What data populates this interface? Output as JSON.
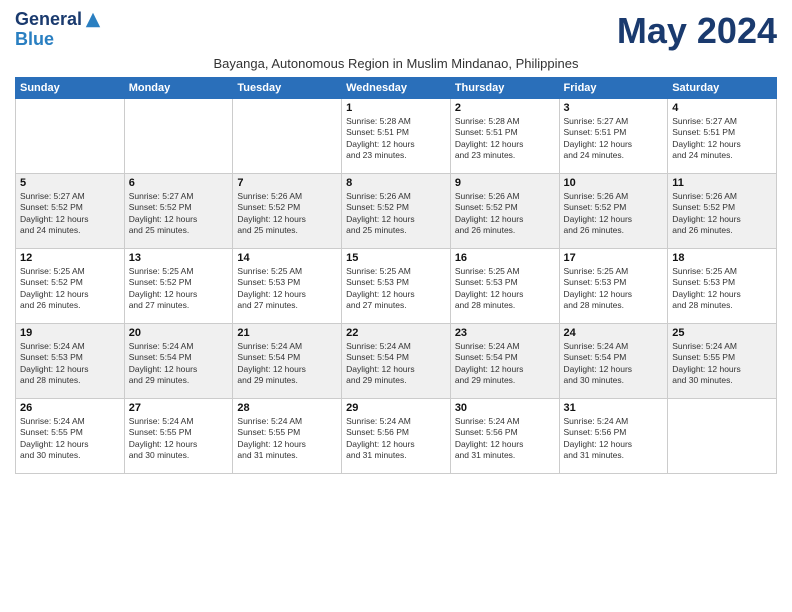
{
  "logo": {
    "line1": "General",
    "line2": "Blue"
  },
  "month": "May 2024",
  "subtitle": "Bayanga, Autonomous Region in Muslim Mindanao, Philippines",
  "days_of_week": [
    "Sunday",
    "Monday",
    "Tuesday",
    "Wednesday",
    "Thursday",
    "Friday",
    "Saturday"
  ],
  "weeks": [
    [
      {
        "day": "",
        "text": ""
      },
      {
        "day": "",
        "text": ""
      },
      {
        "day": "",
        "text": ""
      },
      {
        "day": "1",
        "text": "Sunrise: 5:28 AM\nSunset: 5:51 PM\nDaylight: 12 hours\nand 23 minutes."
      },
      {
        "day": "2",
        "text": "Sunrise: 5:28 AM\nSunset: 5:51 PM\nDaylight: 12 hours\nand 23 minutes."
      },
      {
        "day": "3",
        "text": "Sunrise: 5:27 AM\nSunset: 5:51 PM\nDaylight: 12 hours\nand 24 minutes."
      },
      {
        "day": "4",
        "text": "Sunrise: 5:27 AM\nSunset: 5:51 PM\nDaylight: 12 hours\nand 24 minutes."
      }
    ],
    [
      {
        "day": "5",
        "text": "Sunrise: 5:27 AM\nSunset: 5:52 PM\nDaylight: 12 hours\nand 24 minutes."
      },
      {
        "day": "6",
        "text": "Sunrise: 5:27 AM\nSunset: 5:52 PM\nDaylight: 12 hours\nand 25 minutes."
      },
      {
        "day": "7",
        "text": "Sunrise: 5:26 AM\nSunset: 5:52 PM\nDaylight: 12 hours\nand 25 minutes."
      },
      {
        "day": "8",
        "text": "Sunrise: 5:26 AM\nSunset: 5:52 PM\nDaylight: 12 hours\nand 25 minutes."
      },
      {
        "day": "9",
        "text": "Sunrise: 5:26 AM\nSunset: 5:52 PM\nDaylight: 12 hours\nand 26 minutes."
      },
      {
        "day": "10",
        "text": "Sunrise: 5:26 AM\nSunset: 5:52 PM\nDaylight: 12 hours\nand 26 minutes."
      },
      {
        "day": "11",
        "text": "Sunrise: 5:26 AM\nSunset: 5:52 PM\nDaylight: 12 hours\nand 26 minutes."
      }
    ],
    [
      {
        "day": "12",
        "text": "Sunrise: 5:25 AM\nSunset: 5:52 PM\nDaylight: 12 hours\nand 26 minutes."
      },
      {
        "day": "13",
        "text": "Sunrise: 5:25 AM\nSunset: 5:52 PM\nDaylight: 12 hours\nand 27 minutes."
      },
      {
        "day": "14",
        "text": "Sunrise: 5:25 AM\nSunset: 5:53 PM\nDaylight: 12 hours\nand 27 minutes."
      },
      {
        "day": "15",
        "text": "Sunrise: 5:25 AM\nSunset: 5:53 PM\nDaylight: 12 hours\nand 27 minutes."
      },
      {
        "day": "16",
        "text": "Sunrise: 5:25 AM\nSunset: 5:53 PM\nDaylight: 12 hours\nand 28 minutes."
      },
      {
        "day": "17",
        "text": "Sunrise: 5:25 AM\nSunset: 5:53 PM\nDaylight: 12 hours\nand 28 minutes."
      },
      {
        "day": "18",
        "text": "Sunrise: 5:25 AM\nSunset: 5:53 PM\nDaylight: 12 hours\nand 28 minutes."
      }
    ],
    [
      {
        "day": "19",
        "text": "Sunrise: 5:24 AM\nSunset: 5:53 PM\nDaylight: 12 hours\nand 28 minutes."
      },
      {
        "day": "20",
        "text": "Sunrise: 5:24 AM\nSunset: 5:54 PM\nDaylight: 12 hours\nand 29 minutes."
      },
      {
        "day": "21",
        "text": "Sunrise: 5:24 AM\nSunset: 5:54 PM\nDaylight: 12 hours\nand 29 minutes."
      },
      {
        "day": "22",
        "text": "Sunrise: 5:24 AM\nSunset: 5:54 PM\nDaylight: 12 hours\nand 29 minutes."
      },
      {
        "day": "23",
        "text": "Sunrise: 5:24 AM\nSunset: 5:54 PM\nDaylight: 12 hours\nand 29 minutes."
      },
      {
        "day": "24",
        "text": "Sunrise: 5:24 AM\nSunset: 5:54 PM\nDaylight: 12 hours\nand 30 minutes."
      },
      {
        "day": "25",
        "text": "Sunrise: 5:24 AM\nSunset: 5:55 PM\nDaylight: 12 hours\nand 30 minutes."
      }
    ],
    [
      {
        "day": "26",
        "text": "Sunrise: 5:24 AM\nSunset: 5:55 PM\nDaylight: 12 hours\nand 30 minutes."
      },
      {
        "day": "27",
        "text": "Sunrise: 5:24 AM\nSunset: 5:55 PM\nDaylight: 12 hours\nand 30 minutes."
      },
      {
        "day": "28",
        "text": "Sunrise: 5:24 AM\nSunset: 5:55 PM\nDaylight: 12 hours\nand 31 minutes."
      },
      {
        "day": "29",
        "text": "Sunrise: 5:24 AM\nSunset: 5:56 PM\nDaylight: 12 hours\nand 31 minutes."
      },
      {
        "day": "30",
        "text": "Sunrise: 5:24 AM\nSunset: 5:56 PM\nDaylight: 12 hours\nand 31 minutes."
      },
      {
        "day": "31",
        "text": "Sunrise: 5:24 AM\nSunset: 5:56 PM\nDaylight: 12 hours\nand 31 minutes."
      },
      {
        "day": "",
        "text": ""
      }
    ]
  ]
}
